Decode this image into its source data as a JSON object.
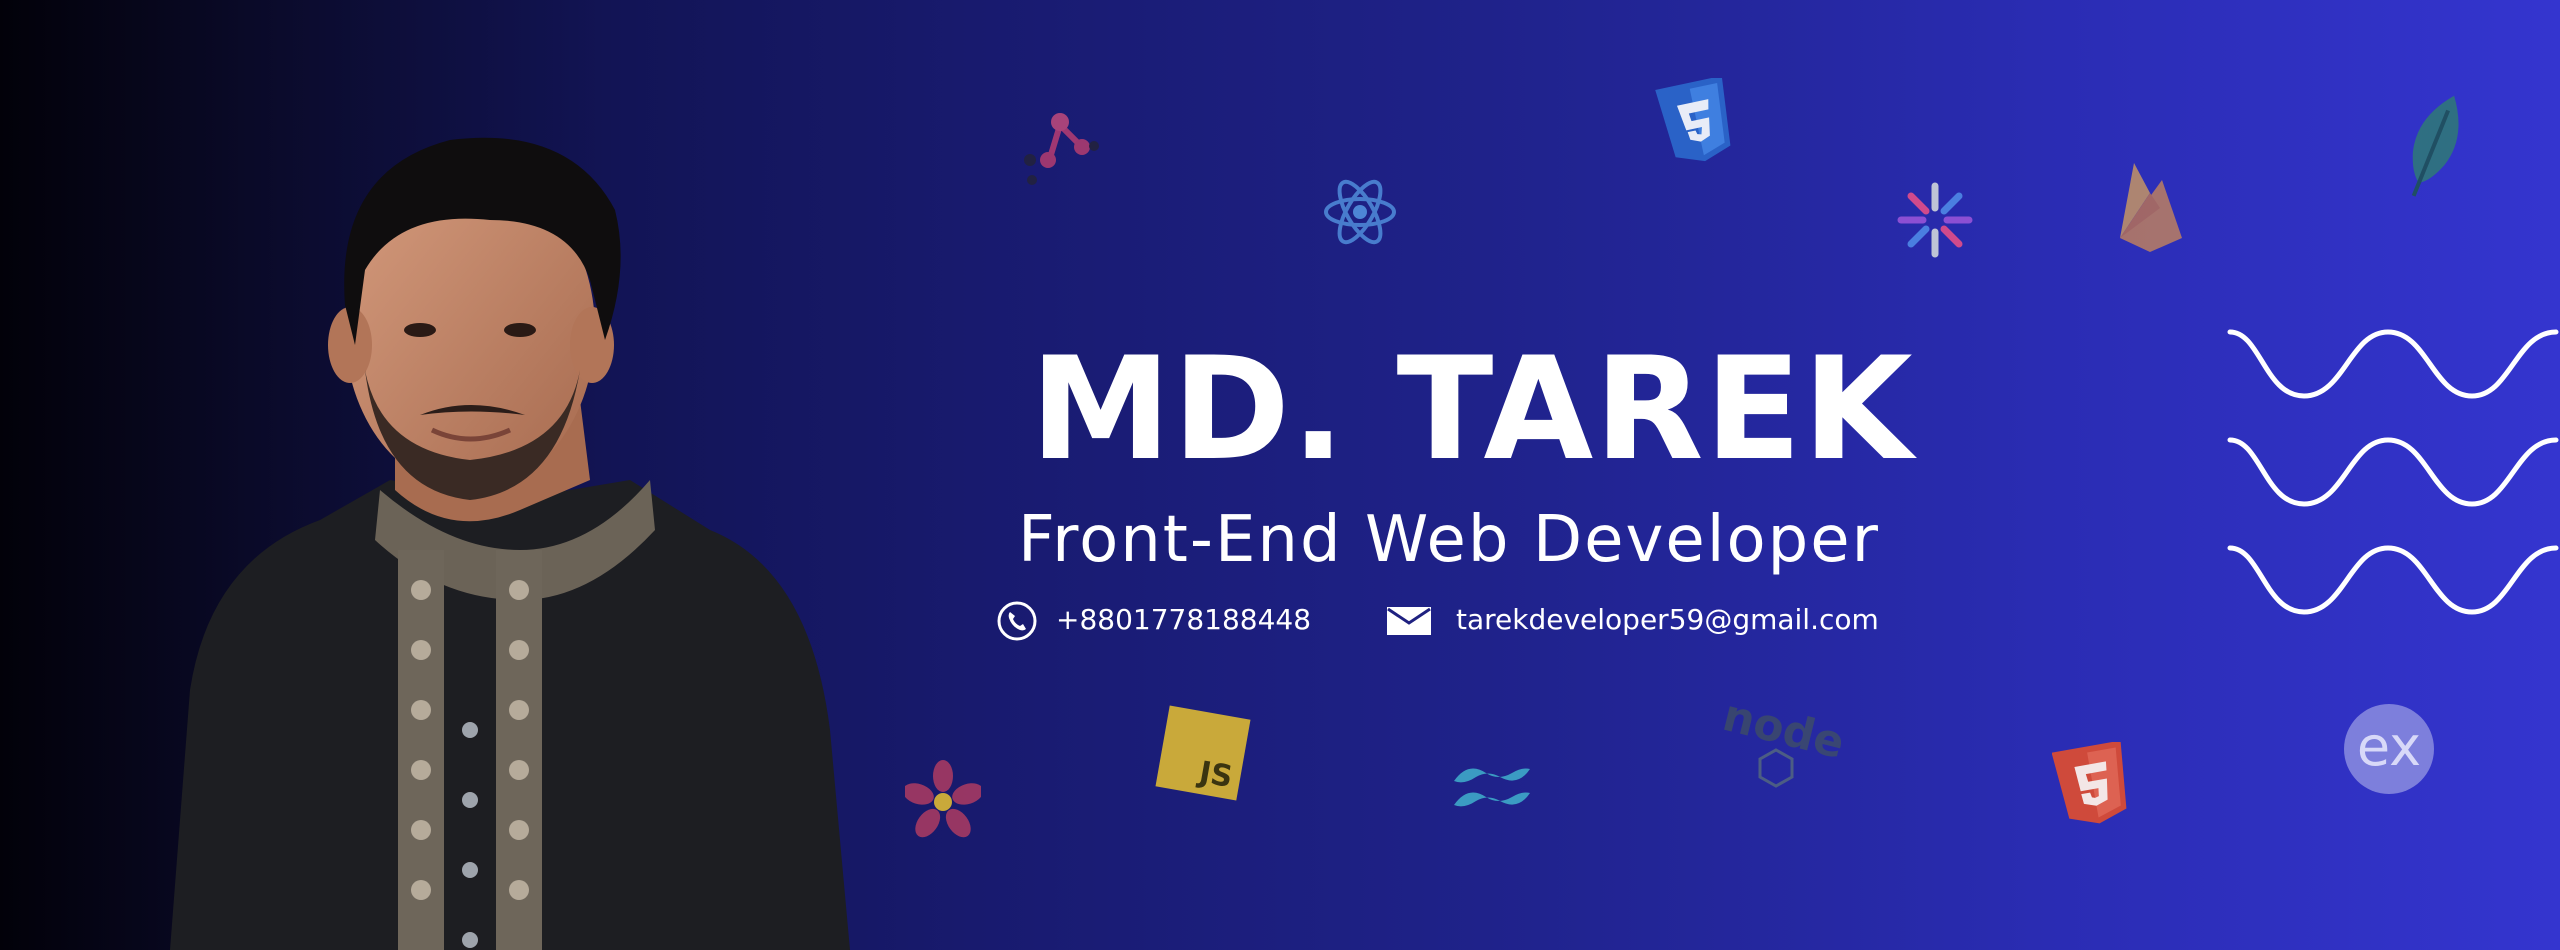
{
  "profile": {
    "name": "MD. TAREK",
    "role": "Front-End Web Developer",
    "phone": "+8801778188448",
    "email": "tarekdeveloper59@gmail.com"
  },
  "icons": {
    "contact": [
      "phone-icon",
      "email-icon"
    ],
    "tech": [
      "graphql-icon",
      "react-icon",
      "css3-icon",
      "jest-icon",
      "firebase-icon",
      "mongodb-icon",
      "javascript-icon",
      "tailwind-icon",
      "nodejs-icon",
      "html5-icon",
      "express-icon",
      "redux-saga-icon"
    ],
    "decoration": [
      "wave-lines"
    ]
  },
  "colors": {
    "background_left": "#020109",
    "background_mid": "#181a6e",
    "background_right": "#3435cf",
    "text": "#ffffff",
    "js_yellow": "#c9a93a",
    "html5_orange": "#e44d26",
    "css3_blue": "#2965f1",
    "react_blue": "#61dafb"
  },
  "labels": {
    "js_badge": "JS",
    "node_word": "node",
    "express_glyph": "ex"
  }
}
